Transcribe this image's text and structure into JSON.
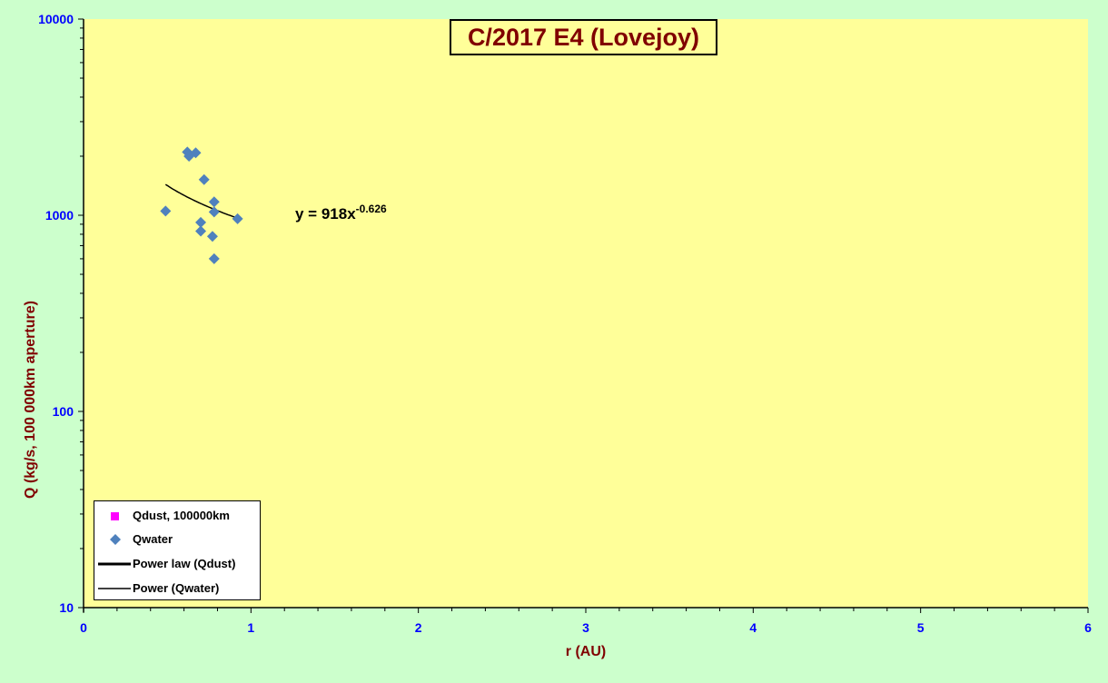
{
  "chart_data": {
    "type": "scatter",
    "title": "C/2017 E4 (Lovejoy)",
    "xlabel": "r (AU)",
    "ylabel": "Q (kg/s, 100 000km aperture)",
    "xlim": [
      0,
      6
    ],
    "ylim": [
      10,
      10000
    ],
    "y_scale": "log",
    "x_ticks": [
      "0",
      "1",
      "2",
      "3",
      "4",
      "5",
      "6"
    ],
    "y_ticks": [
      "10",
      "100",
      "1000",
      "10000"
    ],
    "background_plot": "#ffff99",
    "background_outer": "#ccffcc",
    "grid": false,
    "legend_position": "bottom-left",
    "series": [
      {
        "name": "Qdust, 100000km",
        "marker": "square",
        "color": "#ff00ff",
        "points": []
      },
      {
        "name": "Qwater",
        "marker": "diamond",
        "color": "#4f81bd",
        "points": [
          {
            "x": 0.49,
            "y": 1050
          },
          {
            "x": 0.62,
            "y": 2100
          },
          {
            "x": 0.63,
            "y": 2000
          },
          {
            "x": 0.67,
            "y": 2080
          },
          {
            "x": 0.7,
            "y": 920
          },
          {
            "x": 0.7,
            "y": 830
          },
          {
            "x": 0.72,
            "y": 1520
          },
          {
            "x": 0.77,
            "y": 780
          },
          {
            "x": 0.78,
            "y": 1170
          },
          {
            "x": 0.78,
            "y": 1040
          },
          {
            "x": 0.78,
            "y": 600
          },
          {
            "x": 0.92,
            "y": 960
          }
        ]
      }
    ],
    "fits": [
      {
        "name": "Power law (Qdust)",
        "line_width": 3,
        "color": "#000000",
        "points": []
      },
      {
        "name": "Power (Qwater)",
        "line_width": 1.5,
        "color": "#000000",
        "coef": 918,
        "exponent": -0.626,
        "x_range": [
          0.49,
          0.92
        ]
      }
    ],
    "equation": {
      "prefix": "y = 918x",
      "exponent": "-0.626"
    }
  }
}
